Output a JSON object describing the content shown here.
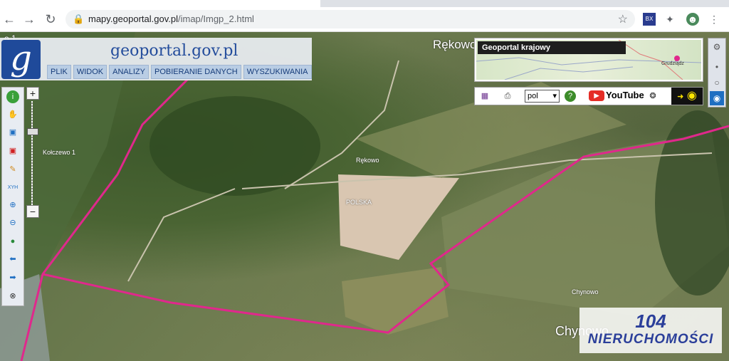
{
  "browser": {
    "url_host": "mapy.geoportal.gov.pl",
    "url_path": "/imap/Imgp_2.html",
    "icons": [
      "back-icon",
      "forward-icon",
      "reload-icon",
      "lock-icon",
      "star-icon",
      "extension-icon",
      "puzzle-icon",
      "profile-icon",
      "menu-dots-icon"
    ]
  },
  "app": {
    "logo_letter": "g",
    "logo_text": "geoportal.gov.pl",
    "menu": [
      "PLIK",
      "WIDOK",
      "ANALIZY",
      "POBIERANIE DANYCH",
      "WYSZUKIWANIA"
    ],
    "overview_title": "Geoportal krajowy",
    "overview_city": "Grudziądz",
    "language": "pol",
    "youtube_label": "YouTube"
  },
  "map_labels": {
    "top_center": "Rękowo",
    "village_1": "Kołczewo 1",
    "village_2": "Rękowo",
    "country": "POLSKA",
    "village_3": "Chynowo",
    "village_3_big": "Chynowo",
    "top_left_fragment": "o 1"
  },
  "watermark": {
    "number": "104",
    "text": "NIERUCHOMOŚCI"
  },
  "colors": {
    "boundary": "#e0288c",
    "brand_blue": "#1f4a9a"
  }
}
